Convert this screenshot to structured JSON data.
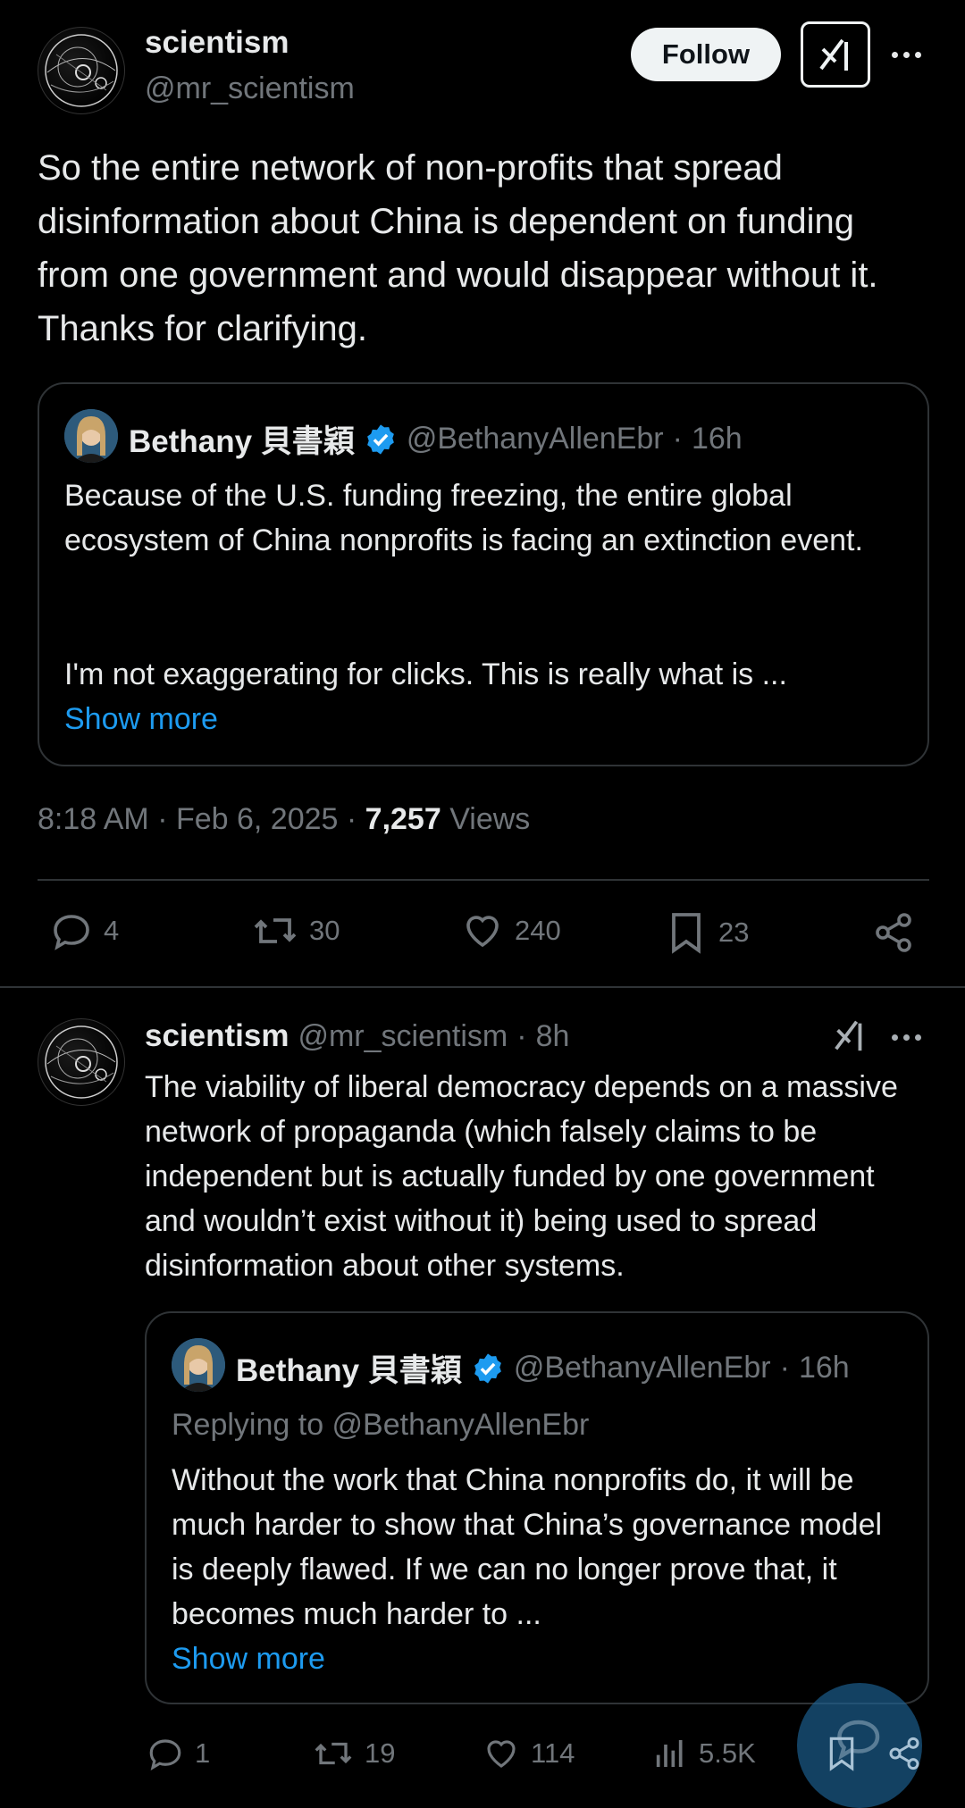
{
  "main_post": {
    "author_name": "scientism",
    "author_handle": "@mr_scientism",
    "follow_label": "Follow",
    "text": "So the entire network of non-profits that spread disinformation about China is dependent on funding from one government and would disappear without it. Thanks for clarifying.",
    "quote": {
      "author_name": "Bethany 貝書穎",
      "author_handle": "@BethanyAllenEbr",
      "sep": "·",
      "time": "16h",
      "text1": "Because of the U.S. funding freezing, the entire global ecosystem of China nonprofits is facing an extinction event.",
      "text2": "I'm not exaggerating for clicks. This is really what is ...",
      "show_more": "Show more"
    },
    "timestamp": "8:18 AM · Feb 6, 2025 ·",
    "views_count": "7,257",
    "views_label": "Views",
    "actions": {
      "replies": "4",
      "reposts": "30",
      "likes": "240",
      "bookmarks": "23"
    }
  },
  "reply_post": {
    "author_name": "scientism",
    "author_handle": "@mr_scientism",
    "sep": "·",
    "time": "8h",
    "text": "The viability of liberal democracy depends on a massive network of propaganda (which falsely claims to be independent but is actually funded by one government and wouldn’t exist without it) being used to spread disinformation about other systems.",
    "quote": {
      "author_name": "Bethany 貝書穎",
      "author_handle": "@BethanyAllenEbr",
      "sep": "·",
      "time": "16h",
      "replying_to": "Replying to @BethanyAllenEbr",
      "text": "Without the work that China nonprofits do, it will be much harder to show that China’s governance model is deeply flawed. If we can no longer prove that, it becomes much harder to ...",
      "show_more": "Show more"
    },
    "actions": {
      "replies": "1",
      "reposts": "19",
      "likes": "114",
      "views": "5.5K"
    }
  },
  "colors": {
    "background": "#000000",
    "text": "#e7e9ea",
    "muted": "#71767b",
    "link": "#1d9bf0",
    "border": "#2f3336",
    "verified": "#1d9bf0"
  },
  "icons": [
    "avatar-sketch",
    "grok-icon",
    "more-icon",
    "verified-icon",
    "reply-icon",
    "repost-icon",
    "like-icon",
    "bookmark-icon",
    "share-icon",
    "views-icon",
    "compose-icon"
  ]
}
